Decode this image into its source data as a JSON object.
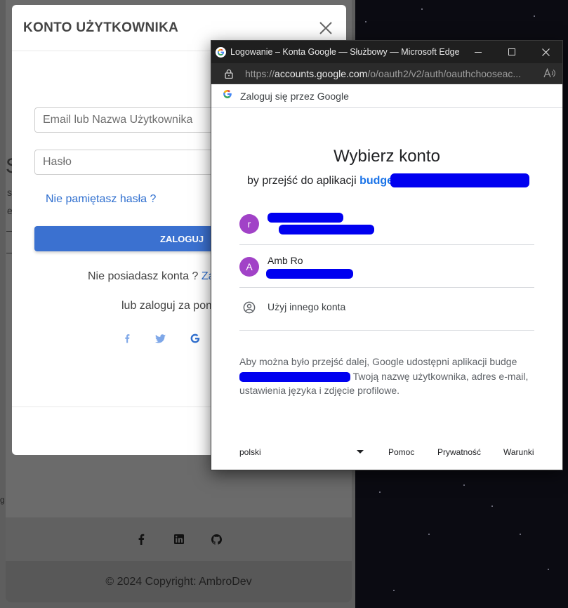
{
  "modal": {
    "title": "KONTO UŻYTKOWNIKA",
    "email_placeholder": "Email lub Nazwa Użytkownika",
    "password_placeholder": "Hasło",
    "forgot_link": "Nie pamiętasz hasła ?",
    "login_button": "ZALOGUJ",
    "no_account_text": "Nie posiadasz konta ?",
    "register_link": "Za",
    "social_text": "lub zaloguj za pom"
  },
  "background": {
    "left_fragments": [
      "S",
      "s",
      "e"
    ],
    "left_g": "g",
    "copyright": "© 2024 Copyright: AmbroDev"
  },
  "popup": {
    "window_title": "Logowanie – Konta Google — Służbowy — Microsoft Edge",
    "url_prefix": "https://",
    "url_host": "accounts.google.com",
    "url_path": "/o/oauth2/v2/auth/oauthchooseac...",
    "sign_in_with": "Zaloguj się przez Google",
    "heading": "Wybierz konto",
    "subheading_prefix": "by przejść do aplikacji",
    "app_name": "budge",
    "accounts": [
      {
        "initial": "r",
        "name": ""
      },
      {
        "initial": "A",
        "name": "Amb Ro"
      }
    ],
    "other_account": "Użyj innego konta",
    "disclaimer_part1": "Aby można było przejść dalej, Google udostępni aplikacji budge",
    "disclaimer_part2": "Twoją nazwę użytkownika, adres e-mail, ustawienia języka i zdjęcie profilowe.",
    "footer": {
      "language": "polski",
      "help": "Pomoc",
      "privacy": "Prywatność",
      "terms": "Warunki"
    }
  },
  "colors": {
    "accent_blue": "#3b71d0",
    "google_blue": "#1a73e8",
    "avatar_purple": "#a142c7",
    "redaction": "#0000f0"
  }
}
